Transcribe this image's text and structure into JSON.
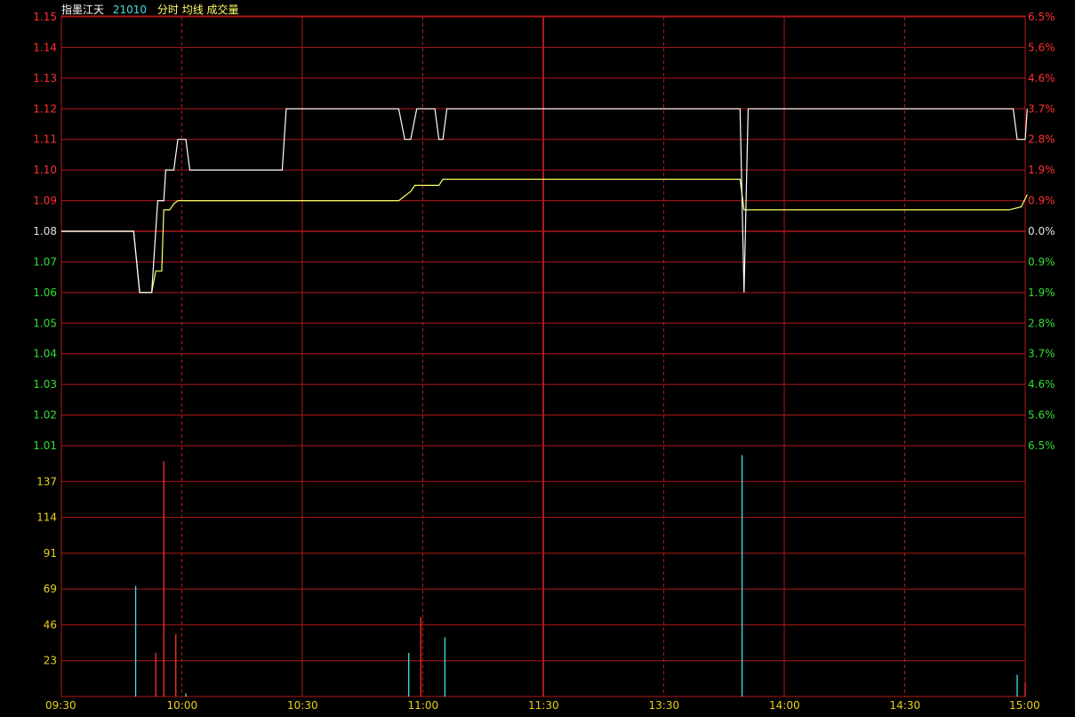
{
  "header": {
    "name": "指墨江天",
    "code": "21010",
    "labels": [
      "分时",
      "均线",
      "成交量"
    ]
  },
  "colors": {
    "background": "#000000",
    "grid": "#b01818",
    "axis_up": "#ff3030",
    "axis_down": "#33dd33",
    "axis_neutral": "#e0e0e0",
    "volume_axis": "#e8d020",
    "time_axis": "#e8d020",
    "price_line": "#ffffff",
    "avg_line": "#ffff66",
    "volume_up": "#ff3030",
    "volume_down": "#40e0e0",
    "header_name": "#ffffff",
    "header_code": "#40e0e0",
    "header_label": "#ffff66"
  },
  "chart_data": [
    {
      "type": "line",
      "prev_close": 1.08,
      "ylim": [
        1.01,
        1.15
      ],
      "y_ticks": [
        "1.15",
        "1.14",
        "1.13",
        "1.12",
        "1.11",
        "1.10",
        "1.09",
        "1.08",
        "1.07",
        "1.06",
        "1.05",
        "1.04",
        "1.03",
        "1.02",
        "1.01"
      ],
      "right_ticks": [
        "6.5%",
        "5.6%",
        "4.6%",
        "3.7%",
        "2.8%",
        "1.9%",
        "0.9%",
        "0.0%",
        "0.9%",
        "1.9%",
        "2.8%",
        "3.7%",
        "4.6%",
        "5.6%",
        "6.5%"
      ],
      "x_ticks": [
        "09:30",
        "10:00",
        "10:30",
        "11:00",
        "11:30",
        "13:30",
        "14:00",
        "14:30",
        "15:00"
      ],
      "xlim": [
        0,
        240
      ],
      "series": [
        {
          "values": [
            [
              0,
              1.08
            ],
            [
              18,
              1.08
            ],
            [
              19.5,
              1.06
            ],
            [
              22.5,
              1.06
            ],
            [
              24,
              1.09
            ],
            [
              25.5,
              1.09
            ],
            [
              26,
              1.1
            ],
            [
              28,
              1.1
            ],
            [
              29,
              1.11
            ],
            [
              31,
              1.11
            ],
            [
              32,
              1.1
            ],
            [
              55,
              1.1
            ],
            [
              56,
              1.12
            ],
            [
              84,
              1.12
            ],
            [
              85.5,
              1.11
            ],
            [
              87,
              1.11
            ],
            [
              88.5,
              1.12
            ],
            [
              93,
              1.12
            ],
            [
              94,
              1.11
            ],
            [
              95,
              1.11
            ],
            [
              96,
              1.12
            ],
            [
              169,
              1.12
            ],
            [
              170,
              1.06
            ],
            [
              171,
              1.12
            ],
            [
              237,
              1.12
            ],
            [
              238,
              1.11
            ],
            [
              240,
              1.11
            ],
            [
              240.5,
              1.12
            ]
          ]
        },
        {
          "values": [
            [
              0,
              1.08
            ],
            [
              18,
              1.08
            ],
            [
              19.5,
              1.06
            ],
            [
              22.5,
              1.06
            ],
            [
              23.5,
              1.067
            ],
            [
              25,
              1.067
            ],
            [
              25.5,
              1.087
            ],
            [
              27,
              1.087
            ],
            [
              28,
              1.089
            ],
            [
              29,
              1.09
            ],
            [
              31,
              1.09
            ],
            [
              84,
              1.09
            ],
            [
              85,
              1.091
            ],
            [
              87,
              1.093
            ],
            [
              88,
              1.095
            ],
            [
              94,
              1.095
            ],
            [
              95,
              1.097
            ],
            [
              169,
              1.097
            ],
            [
              170,
              1.087
            ],
            [
              236,
              1.087
            ],
            [
              239,
              1.088
            ],
            [
              240.5,
              1.092
            ]
          ]
        }
      ]
    },
    {
      "type": "bar",
      "y_ticks": [
        "137",
        "114",
        "91",
        "69",
        "46",
        "23"
      ],
      "bars": [
        {
          "t": 18.5,
          "v": 71,
          "dir": "down"
        },
        {
          "t": 23.5,
          "v": 28,
          "dir": "up"
        },
        {
          "t": 25.5,
          "v": 151,
          "dir": "up"
        },
        {
          "t": 28.5,
          "v": 40,
          "dir": "up"
        },
        {
          "t": 31,
          "v": 2,
          "dir": "down"
        },
        {
          "t": 86.5,
          "v": 28,
          "dir": "down"
        },
        {
          "t": 89.5,
          "v": 51,
          "dir": "up"
        },
        {
          "t": 95.5,
          "v": 38,
          "dir": "down"
        },
        {
          "t": 169.5,
          "v": 155,
          "dir": "down"
        },
        {
          "t": 238,
          "v": 14,
          "dir": "down"
        },
        {
          "t": 240,
          "v": 9,
          "dir": "up"
        }
      ]
    }
  ]
}
